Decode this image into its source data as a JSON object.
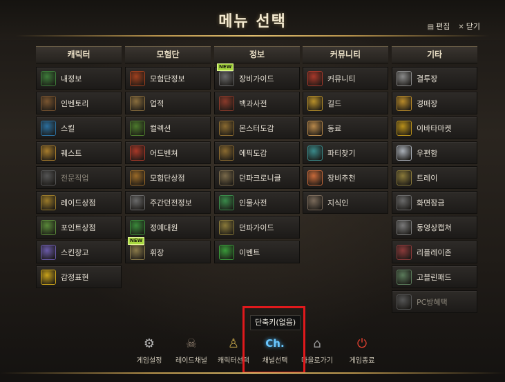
{
  "title": "메뉴 선택",
  "top_links": {
    "edit": "편집",
    "close": "닫기"
  },
  "columns": [
    {
      "header": "캐릭터",
      "items": [
        {
          "label": "내정보",
          "icon": "character-info-icon",
          "color": "#3d7d3a"
        },
        {
          "label": "인벤토리",
          "icon": "inventory-chest-icon",
          "color": "#7a5530"
        },
        {
          "label": "스킬",
          "icon": "skill-spark-icon",
          "color": "#2b6f9e"
        },
        {
          "label": "퀘스트",
          "icon": "quest-scroll-icon",
          "color": "#a77c2c"
        },
        {
          "label": "전문직업",
          "icon": "profession-flask-icon",
          "color": "#555",
          "dim": true
        },
        {
          "label": "레이드상점",
          "icon": "raid-shop-chest-icon",
          "color": "#9a7a2a"
        },
        {
          "label": "포인트상점",
          "icon": "point-shop-coin-icon",
          "color": "#5a8a3a"
        },
        {
          "label": "스킨창고",
          "icon": "skin-brush-icon",
          "color": "#6a5aa8"
        },
        {
          "label": "감정표현",
          "icon": "emote-smiley-icon",
          "color": "#c9a21a"
        }
      ]
    },
    {
      "header": "모험단",
      "items": [
        {
          "label": "모험단정보",
          "icon": "adventure-banner-icon",
          "color": "#a0401e"
        },
        {
          "label": "업적",
          "icon": "achievement-scroll-icon",
          "color": "#8a6e3e"
        },
        {
          "label": "컬렉션",
          "icon": "collection-card-icon",
          "color": "#4c7a2c"
        },
        {
          "label": "어드벤쳐",
          "icon": "adventure-wings-icon",
          "color": "#a83828"
        },
        {
          "label": "모험단상점",
          "icon": "adventure-shop-icon",
          "color": "#9a6a28"
        },
        {
          "label": "주간던전정보",
          "icon": "weekly-dungeon-gate-icon",
          "color": "#6a6a6a"
        },
        {
          "label": "정예대원",
          "icon": "elite-member-icon",
          "color": "#3a8a3a"
        },
        {
          "label": "휘장",
          "icon": "emblem-badge-icon",
          "color": "#8a7a4a",
          "new": true
        }
      ]
    },
    {
      "header": "정보",
      "items": [
        {
          "label": "장비가이드",
          "icon": "equipment-guide-icon",
          "color": "#6a6a6a",
          "new": true
        },
        {
          "label": "백과사전",
          "icon": "encyclopedia-book-icon",
          "color": "#8a3a2a"
        },
        {
          "label": "몬스터도감",
          "icon": "monster-book-icon",
          "color": "#8a6a30"
        },
        {
          "label": "에픽도감",
          "icon": "epic-book-icon",
          "color": "#8a6a30"
        },
        {
          "label": "던파크로니클",
          "icon": "chronicle-star-icon",
          "color": "#7a6a4a"
        },
        {
          "label": "인물사전",
          "icon": "character-dictionary-icon",
          "color": "#3a8a4a"
        },
        {
          "label": "던파가이드",
          "icon": "guide-signpost-icon",
          "color": "#8a7a3a"
        },
        {
          "label": "이벤트",
          "icon": "event-calendar-icon",
          "color": "#3a9a3a"
        }
      ]
    },
    {
      "header": "커뮤니티",
      "items": [
        {
          "label": "커뮤니티",
          "icon": "community-shield-icon",
          "color": "#a8382a"
        },
        {
          "label": "길드",
          "icon": "guild-emblem-icon",
          "color": "#b8902a"
        },
        {
          "label": "동료",
          "icon": "handshake-icon",
          "color": "#b8884a"
        },
        {
          "label": "파티찾기",
          "icon": "party-members-icon",
          "color": "#3a8a8a"
        },
        {
          "label": "장비추천",
          "icon": "equipment-recommend-icon",
          "color": "#c86a3a"
        },
        {
          "label": "지식인",
          "icon": "knowledge-hat-icon",
          "color": "#7a6a5a"
        }
      ]
    },
    {
      "header": "기타",
      "items": [
        {
          "label": "결투장",
          "icon": "crossed-swords-icon",
          "color": "#8a8a8a"
        },
        {
          "label": "경매장",
          "icon": "auction-gavel-icon",
          "color": "#b88a2a"
        },
        {
          "label": "이바타마켓",
          "icon": "avatar-market-icon",
          "color": "#b8901a"
        },
        {
          "label": "우편함",
          "icon": "mail-envelope-icon",
          "color": "#aab0b8"
        },
        {
          "label": "트레이",
          "icon": "tray-icon",
          "color": "#8a7a3a"
        },
        {
          "label": "화면잠금",
          "icon": "lock-icon",
          "color": "#6a6a6a"
        },
        {
          "label": "동영상캡쳐",
          "icon": "video-camera-icon",
          "color": "#7a7a7a"
        },
        {
          "label": "리플레이존",
          "icon": "replay-film-icon",
          "color": "#8a3a3a"
        },
        {
          "label": "고블린패드",
          "icon": "goblin-pad-icon",
          "color": "#5a7a5a"
        },
        {
          "label": "PC방혜택",
          "icon": "pc-room-monitor-icon",
          "color": "#555",
          "dim": true
        }
      ]
    }
  ],
  "bottom": [
    {
      "label": "게임설정",
      "icon": "gear-icon",
      "glyph": "⚙",
      "color": "#b8b8b8"
    },
    {
      "label": "레이드채널",
      "icon": "raid-skull-icon",
      "glyph": "☠",
      "color": "#8a7a6a"
    },
    {
      "label": "캐릭터선택",
      "icon": "character-select-icon",
      "glyph": "♙",
      "color": "#c8a84a"
    },
    {
      "label": "채널선택",
      "icon": "channel-icon",
      "glyph": "Ch.",
      "color": "#6ac8ff"
    },
    {
      "label": "마을로가기",
      "icon": "home-icon",
      "glyph": "⌂",
      "color": "#9a9a9a"
    },
    {
      "label": "게임종료",
      "icon": "power-icon",
      "glyph": "⏻",
      "color": "#e04030"
    }
  ],
  "tooltip": "단축키(없음)"
}
